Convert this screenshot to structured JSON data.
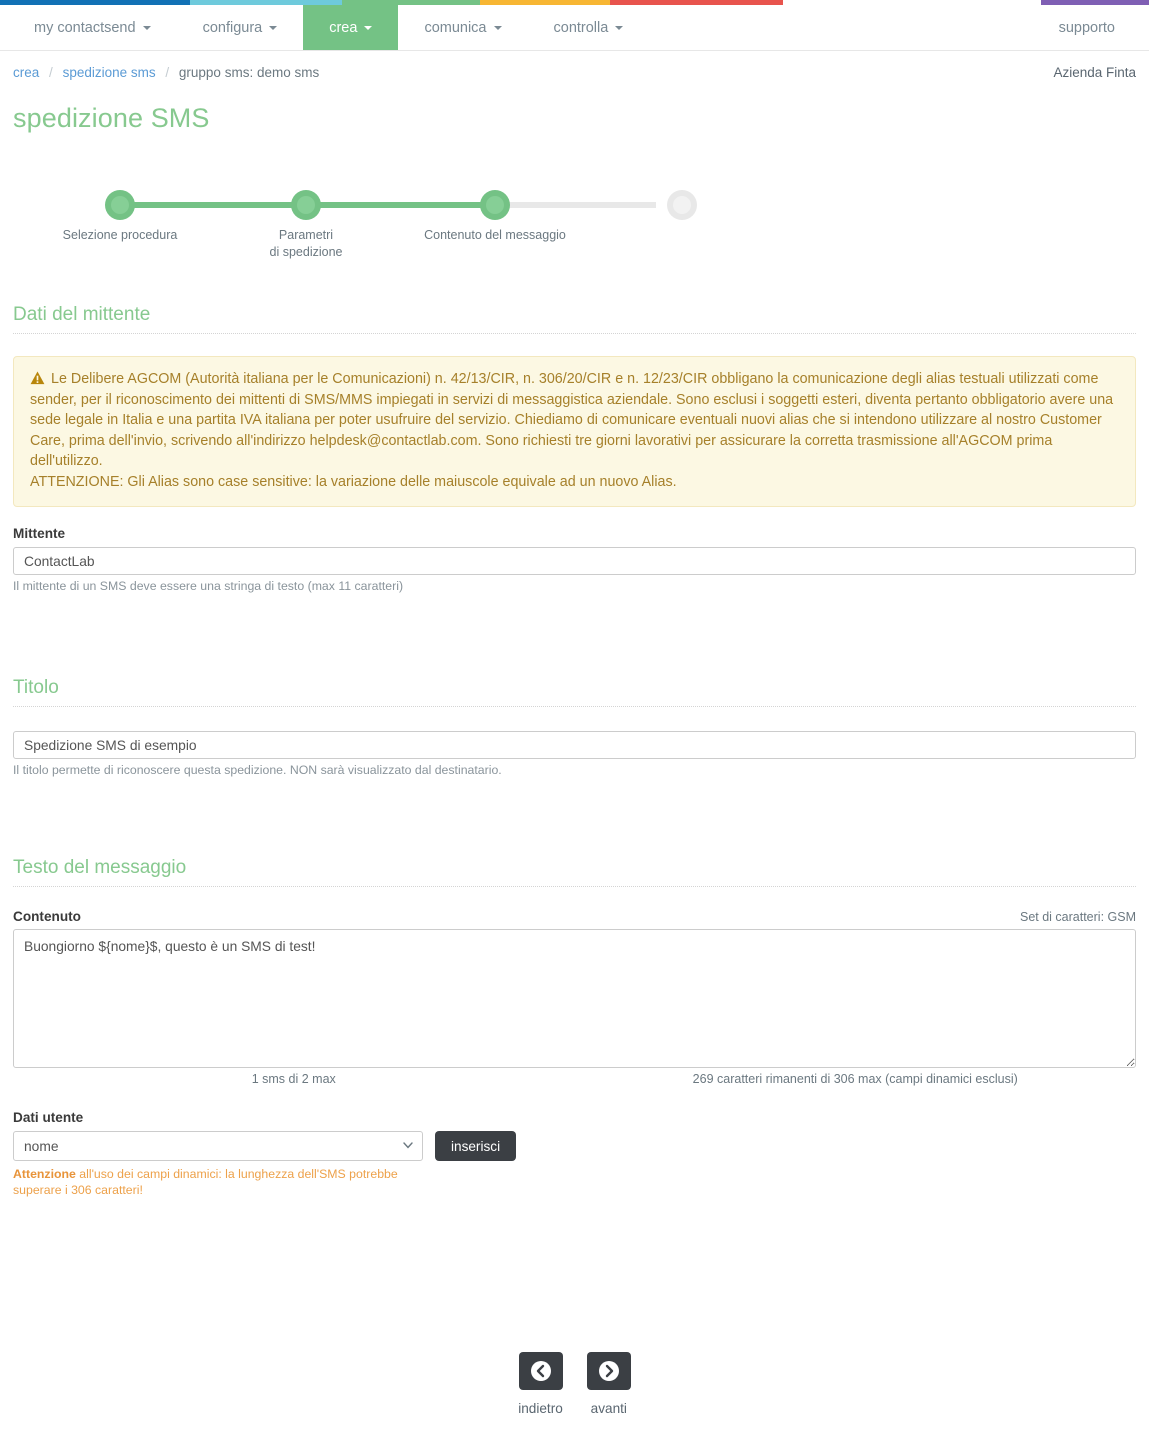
{
  "brand_colors": {
    "stripe": [
      "#1271b5",
      "#6ecadc",
      "#74c285",
      "#f7b633",
      "#e8544d",
      "#7f5fb4"
    ],
    "accent_green": "#74c285",
    "heading_green": "#87c98f",
    "alert_bg": "#fcf8e3",
    "alert_text": "#a6802a",
    "warning_orange": "#eda14a",
    "dark_button": "#3b3f44",
    "link_blue": "#5b9bd5"
  },
  "navbar": {
    "items": [
      {
        "label": "my contactsend",
        "has_caret": true,
        "active": false
      },
      {
        "label": "configura",
        "has_caret": true,
        "active": false
      },
      {
        "label": "crea",
        "has_caret": true,
        "active": true
      },
      {
        "label": "comunica",
        "has_caret": true,
        "active": false
      },
      {
        "label": "controlla",
        "has_caret": true,
        "active": false
      }
    ],
    "support": {
      "label": "supporto",
      "has_caret": false
    }
  },
  "breadcrumb": {
    "item1": "crea",
    "sep1": "/",
    "item2": "spedizione sms",
    "sep2": "/",
    "item3": "gruppo sms: demo sms"
  },
  "company": "Azienda Finta",
  "page_title": "spedizione SMS",
  "stepper": {
    "steps": [
      {
        "label": "Selezione procedura",
        "state": "done"
      },
      {
        "label": "Parametri\ndi spedizione",
        "label_line1": "Parametri",
        "label_line2": "di spedizione",
        "state": "done"
      },
      {
        "label": "Contenuto del messaggio",
        "state": "done"
      },
      {
        "label": "",
        "state": "pending"
      }
    ]
  },
  "sections": {
    "mittente_heading": "Dati del mittente",
    "titolo_heading": "Titolo",
    "testo_heading": "Testo del messaggio"
  },
  "alert": {
    "icon": "warning-triangle-icon",
    "paragraph1": "Le Delibere AGCOM (Autorità italiana per le Comunicazioni) n. 42/13/CIR, n. 306/20/CIR e n. 12/23/CIR obbligano la comunicazione degli alias testuali utilizzati come sender, per il riconoscimento dei mittenti di SMS/MMS impiegati in servizi di messaggistica aziendale. Sono esclusi i soggetti esteri, diventa pertanto obbligatorio avere una sede legale in Italia e una partita IVA italiana per poter usufruire del servizio. Chiediamo di comunicare eventuali nuovi alias che si intendono utilizzare al nostro Customer Care, prima dell'invio, scrivendo all'indirizzo helpdesk@contactlab.com. Sono richiesti tre giorni lavorativi per assicurare la corretta trasmissione all'AGCOM prima dell'utilizzo.",
    "paragraph2": "ATTENZIONE: Gli Alias sono case sensitive: la variazione delle maiuscole equivale ad un nuovo Alias."
  },
  "mittente": {
    "label": "Mittente",
    "value": "ContactLab",
    "placeholder": "",
    "help": "Il mittente di un SMS deve essere una stringa di testo (max 11 caratteri)"
  },
  "titolo": {
    "value": "Spedizione SMS di esempio",
    "placeholder": "",
    "help": "Il titolo permette di riconoscere questa spedizione. NON sarà visualizzato dal destinatario."
  },
  "contenuto": {
    "label": "Contenuto",
    "charset_note": "Set di caratteri: GSM",
    "value": "Buongiorno ${nome}$, questo è un SMS di test!",
    "placeholder": "",
    "sms_count": "1 sms di 2 max",
    "chars_remaining": "269 caratteri rimanenti di 306 max (campi dinamici esclusi)"
  },
  "dati_utente": {
    "label": "Dati utente",
    "selected": "nome",
    "options": [
      "nome"
    ],
    "insert_button": "inserisci",
    "warning_bold": "Attenzione",
    "warning_text": " all'uso dei campi dinamici: la lunghezza dell'SMS potrebbe superare i 306 caratteri!"
  },
  "bottom_nav": {
    "back": {
      "label": "indietro",
      "icon": "chevron-left-circle-icon"
    },
    "next": {
      "label": "avanti",
      "icon": "chevron-right-circle-icon"
    }
  }
}
